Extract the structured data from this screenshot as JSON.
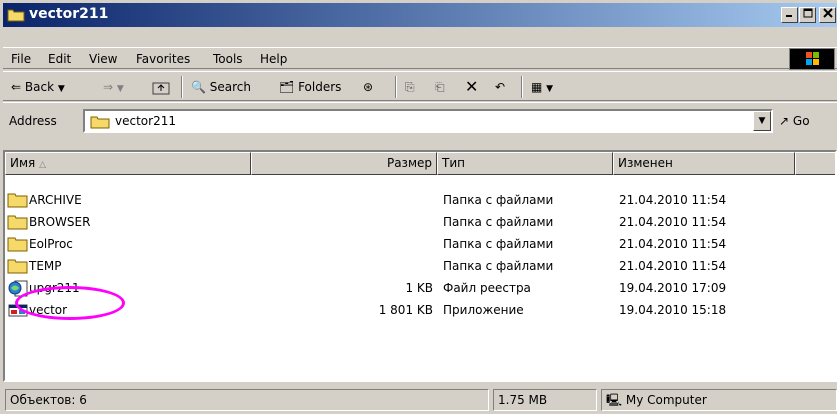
{
  "window": {
    "title": "vector211"
  },
  "menu": {
    "items": [
      {
        "label": "File"
      },
      {
        "label": "Edit"
      },
      {
        "label": "View"
      },
      {
        "label": "Favorites"
      },
      {
        "label": "Tools"
      },
      {
        "label": "Help"
      }
    ]
  },
  "toolbar": {
    "back_label": "Back",
    "search_label": "Search",
    "folders_label": "Folders"
  },
  "address": {
    "label": "Address",
    "value": "vector211",
    "go_label": "Go"
  },
  "columns": [
    {
      "label": "Имя"
    },
    {
      "label": "Размер"
    },
    {
      "label": "Тип"
    },
    {
      "label": "Изменен"
    }
  ],
  "files": [
    {
      "name": "ARCHIVE",
      "size": "",
      "type": "Папка с файлами",
      "modified": "21.04.2010 11:54",
      "icon": "folder-icon"
    },
    {
      "name": "BROWSER",
      "size": "",
      "type": "Папка с файлами",
      "modified": "21.04.2010 11:54",
      "icon": "folder-icon"
    },
    {
      "name": "EolProc",
      "size": "",
      "type": "Папка с файлами",
      "modified": "21.04.2010 11:54",
      "icon": "folder-icon"
    },
    {
      "name": "TEMP",
      "size": "",
      "type": "Папка с файлами",
      "modified": "21.04.2010 11:54",
      "icon": "folder-icon"
    },
    {
      "name": "upgr211",
      "size": "1 KB",
      "type": "Файл реестра",
      "modified": "19.04.2010 17:09",
      "icon": "registry-file-icon"
    },
    {
      "name": "vector",
      "size": "1 801 KB",
      "type": "Приложение",
      "modified": "19.04.2010 15:18",
      "icon": "application-icon"
    }
  ],
  "status": {
    "objects": "Объектов: 6",
    "size": "1.75 MB",
    "location": "My Computer"
  },
  "colors": {
    "title_start": "#0a246a",
    "title_end": "#a6caf0",
    "highlight": "#ff00ff",
    "folder": "#f5d96a"
  }
}
